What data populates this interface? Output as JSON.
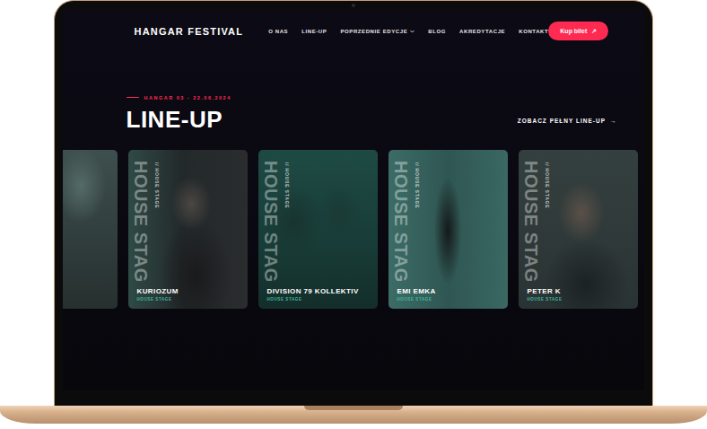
{
  "nav": {
    "logo": "HANGAR FESTIVAL",
    "items": [
      {
        "label": "O NAS",
        "kind": "link"
      },
      {
        "label": "LINE-UP",
        "kind": "link"
      },
      {
        "label": "POPRZEDNIE EDYCJE",
        "kind": "dropdown"
      },
      {
        "label": "BLOG",
        "kind": "link"
      },
      {
        "label": "AKREDYTACJE",
        "kind": "link"
      },
      {
        "label": "KONTAKT",
        "kind": "link"
      }
    ],
    "cta": {
      "label": "Kup bilet",
      "icon": "↗"
    }
  },
  "section": {
    "eyebrow": "HANGAR 03 - 22.06.2024",
    "title": "LINE-UP",
    "link": "ZOBACZ PEŁNY LINE-UP",
    "link_icon": "→"
  },
  "cards": [
    {
      "kind": "partial"
    },
    {
      "kind": "artist",
      "name": "KURIOZUM",
      "stage": "HOUSE STAG",
      "stage_tag": "// HOUSE STAGE",
      "subtitle": "HOUSE STAGE"
    },
    {
      "kind": "artist",
      "name": "DIVISION 79 KOLLEKTIV",
      "stage": "HOUSE STAG",
      "stage_tag": "// HOUSE STAGE",
      "subtitle": "HOUSE STAGE"
    },
    {
      "kind": "artist",
      "name": "EMI EMKA",
      "stage": "HOUSE STAG",
      "stage_tag": "// HOUSE STAGE",
      "subtitle": "HOUSE STAGE"
    },
    {
      "kind": "artist",
      "name": "PETER K",
      "stage": "HOUSE STAG",
      "stage_tag": "// HOUSE STAGE",
      "subtitle": "HOUSE STAGE"
    }
  ]
}
